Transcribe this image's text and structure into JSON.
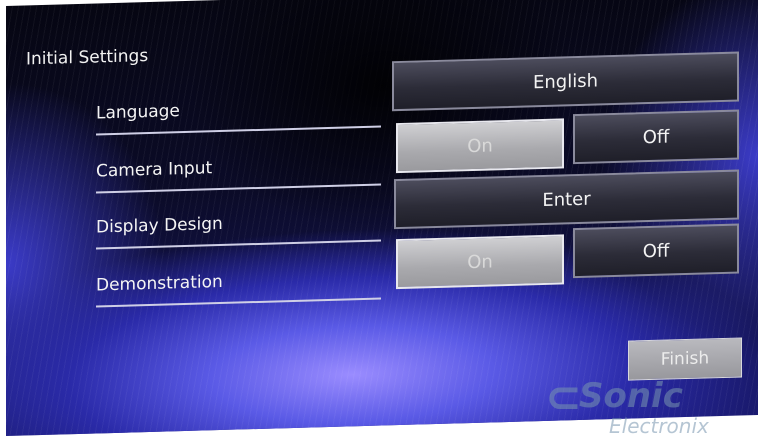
{
  "screen_title": "Initial Settings",
  "rows": [
    {
      "label": "Language",
      "button": "English"
    },
    {
      "label": "Camera Input",
      "on": "On",
      "off": "Off",
      "selected": "On"
    },
    {
      "label": "Display Design",
      "button": "Enter"
    },
    {
      "label": "Demonstration",
      "on": "On",
      "off": "Off",
      "selected": "On"
    }
  ],
  "finish_label": "Finish",
  "watermark": {
    "brand": "Sonic",
    "sub": "Electronix"
  }
}
